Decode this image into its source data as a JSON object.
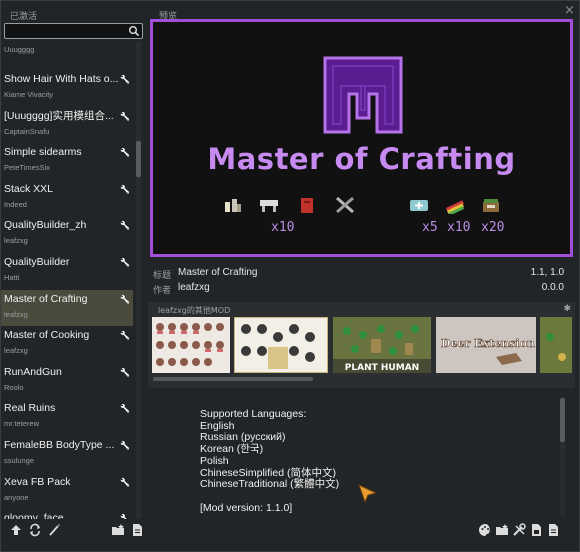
{
  "left_panel": {
    "header": "已激活",
    "search": {
      "value": "",
      "placeholder": ""
    },
    "items": [
      {
        "title": "",
        "author": "Uuugggg",
        "selected": false,
        "check": false
      },
      {
        "title": "Show Hair With Hats o...",
        "author": "Kiame Vivacity",
        "selected": false,
        "check": true
      },
      {
        "title": "[Uuugggg]实用模组合...",
        "author": "CaptainSnafu",
        "selected": false,
        "check": true
      },
      {
        "title": "Simple sidearms",
        "author": "PeteTimesSix",
        "selected": false,
        "check": true
      },
      {
        "title": "Stack XXL",
        "author": "Indeed",
        "selected": false,
        "check": true
      },
      {
        "title": "QualityBuilder_zh",
        "author": "leafzxg",
        "selected": false,
        "check": true
      },
      {
        "title": "QualityBuilder",
        "author": "Hatti",
        "selected": false,
        "check": true
      },
      {
        "title": "Master of Crafting",
        "author": "leafzxg",
        "selected": true,
        "check": true
      },
      {
        "title": "Master of Cooking",
        "author": "leafzxg",
        "selected": false,
        "check": true
      },
      {
        "title": "RunAndGun",
        "author": "Roolo",
        "selected": false,
        "check": true
      },
      {
        "title": "Real Ruins",
        "author": "mr.teterew",
        "selected": false,
        "check": true
      },
      {
        "title": "FemaleBB BodyType ...",
        "author": "ssulunge",
        "selected": false,
        "check": true
      },
      {
        "title": "Xeva FB Pack",
        "author": "anyone",
        "selected": false,
        "check": true
      },
      {
        "title": "gloomy_face",
        "author": "",
        "selected": false,
        "check": true
      }
    ]
  },
  "preview": {
    "header": "预览",
    "title": "Master of Crafting",
    "multipliers": {
      "left": "x10",
      "right1": "x5",
      "right2": "x10",
      "right3": "x20"
    },
    "accent": "#a14fd8",
    "title_color": "#c68af0"
  },
  "meta": {
    "title_label": "标题",
    "title_value": "Master of Crafting",
    "author_label": "作者",
    "author_value": "leafzxg",
    "game_versions": "1.1, 1.0",
    "mod_version": "0.0.0"
  },
  "gallery": {
    "label": "leafzxg的其他MOD",
    "thumbs": [
      {
        "caption": ""
      },
      {
        "caption": ""
      },
      {
        "caption": "PLANT HUMAN"
      },
      {
        "caption": "Deer Extension"
      },
      {
        "caption": ""
      }
    ]
  },
  "description": {
    "lines": [
      "Supported Languages:",
      "English",
      "Russian (русский)",
      "Korean (한국)",
      "Polish",
      "ChineseSimplified (简体中文)",
      "ChineseTraditional (繁體中文)",
      "",
      "[Mod version: 1.1.0]"
    ]
  },
  "icons": {
    "search": "search-icon",
    "close": "close-icon",
    "bottom_left": [
      "upload-icon",
      "refresh-icon",
      "wand-icon"
    ],
    "bottom_mid": [
      "folder-icon",
      "document-icon"
    ],
    "bottom_right": [
      "palette-icon",
      "folder-icon",
      "tools-icon",
      "save-document-icon",
      "document-icon"
    ]
  }
}
